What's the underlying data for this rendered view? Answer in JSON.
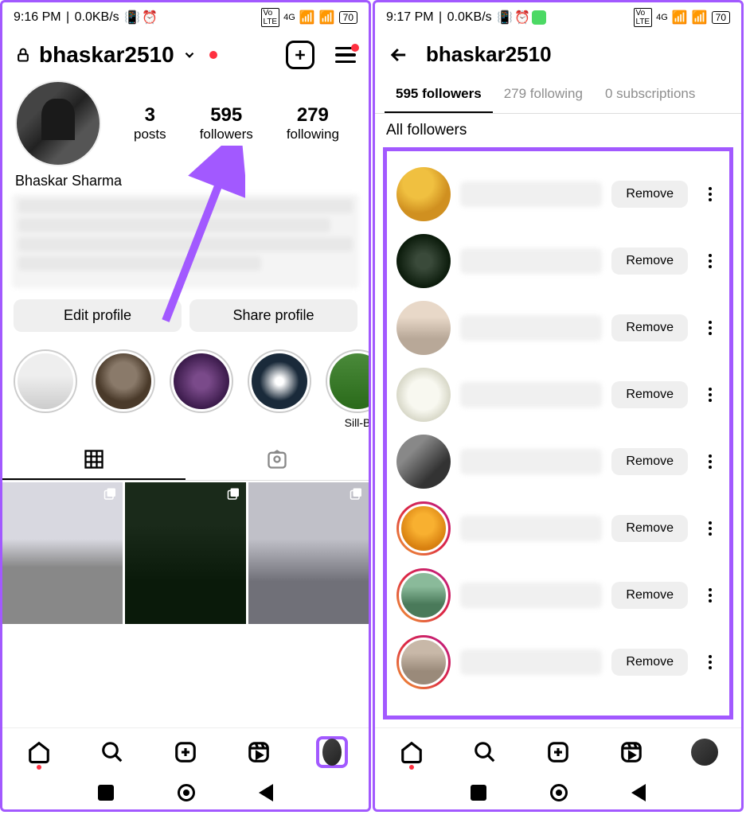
{
  "left": {
    "status": {
      "time": "9:16 PM",
      "net": "0.0KB/s",
      "battery": "70",
      "signal": "4G"
    },
    "username": "bhaskar2510",
    "stats": {
      "posts": {
        "n": "3",
        "l": "posts"
      },
      "followers": {
        "n": "595",
        "l": "followers"
      },
      "following": {
        "n": "279",
        "l": "following"
      }
    },
    "displayName": "Bhaskar Sharma",
    "buttons": {
      "edit": "Edit profile",
      "share": "Share profile"
    },
    "highlights": [
      "",
      "",
      "",
      "",
      "Sill-B"
    ]
  },
  "right": {
    "status": {
      "time": "9:17 PM",
      "net": "0.0KB/s",
      "battery": "70",
      "signal": "4G"
    },
    "title": "bhaskar2510",
    "tabs": {
      "followers": "595 followers",
      "following": "279 following",
      "subs": "0 subscriptions"
    },
    "section": "All followers",
    "removeLabel": "Remove",
    "rows": [
      {
        "ring": false,
        "cls": "fa1"
      },
      {
        "ring": false,
        "cls": "fa2"
      },
      {
        "ring": false,
        "cls": "fa3"
      },
      {
        "ring": false,
        "cls": "fa4"
      },
      {
        "ring": false,
        "cls": "fa5"
      },
      {
        "ring": true,
        "cls": "fa6"
      },
      {
        "ring": true,
        "cls": "fa7"
      },
      {
        "ring": true,
        "cls": "fa8"
      }
    ]
  }
}
